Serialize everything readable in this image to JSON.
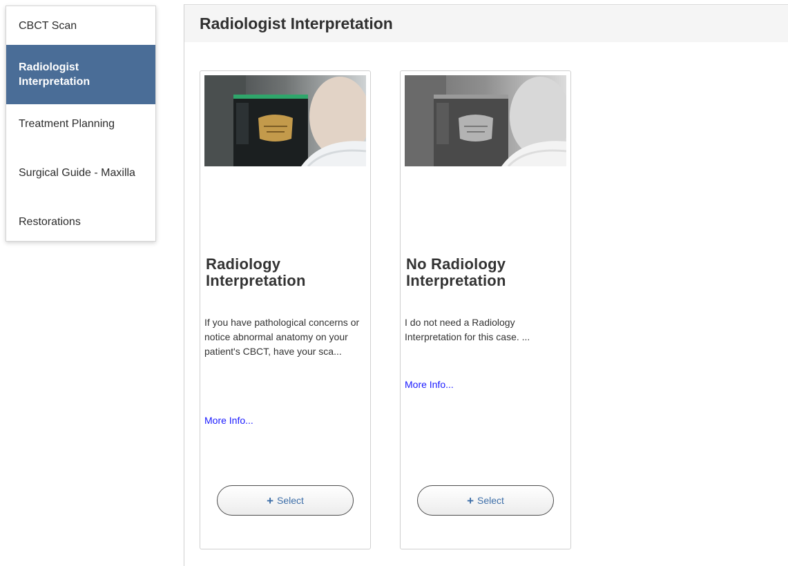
{
  "sidebar": {
    "items": [
      {
        "label": "CBCT Scan",
        "active": false
      },
      {
        "label": "Radiologist Interpretation",
        "active": true
      },
      {
        "label": "Treatment Planning",
        "active": false
      },
      {
        "label": "Surgical Guide - Maxilla",
        "active": false
      },
      {
        "label": "Restorations",
        "active": false
      }
    ]
  },
  "main": {
    "title": "Radiologist Interpretation"
  },
  "cards": [
    {
      "title": "Radiology Interpretation",
      "description": "If you have pathological concerns or notice abnormal anatomy on your patient's CBCT, have your sca...",
      "more_label": "More Info...",
      "select_label": "Select",
      "image_style": "color"
    },
    {
      "title": "No Radiology Interpretation",
      "description": "I do not need a Radiology Interpretation for this case. ...",
      "more_label": "More Info...",
      "select_label": "Select",
      "image_style": "grayscale"
    }
  ],
  "colors": {
    "active_bg": "#4a6d97",
    "link": "#1a1aff",
    "button_text": "#3d6ea8"
  }
}
